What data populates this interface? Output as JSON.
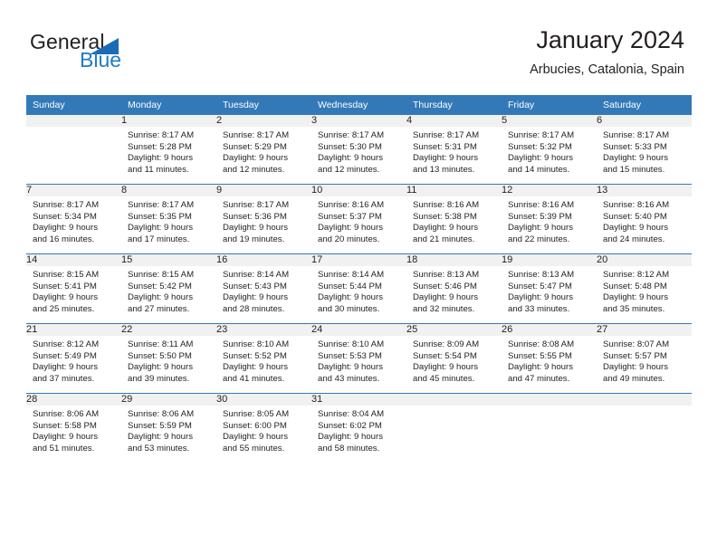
{
  "brand": {
    "name_part1": "General",
    "name_part2": "Blue",
    "accent_color": "#1f7cc4",
    "triangle_color": "#1b6cb5"
  },
  "header": {
    "title": "January 2024",
    "subtitle": "Arbucies, Catalonia, Spain"
  },
  "calendar": {
    "header_bg": "#3379b8",
    "daynum_bg": "#f1f1f1",
    "columns": [
      "Sunday",
      "Monday",
      "Tuesday",
      "Wednesday",
      "Thursday",
      "Friday",
      "Saturday"
    ],
    "weeks": [
      [
        {
          "day": "",
          "lines": [
            "",
            "",
            "",
            ""
          ]
        },
        {
          "day": "1",
          "lines": [
            "Sunrise: 8:17 AM",
            "Sunset: 5:28 PM",
            "Daylight: 9 hours",
            "and 11 minutes."
          ]
        },
        {
          "day": "2",
          "lines": [
            "Sunrise: 8:17 AM",
            "Sunset: 5:29 PM",
            "Daylight: 9 hours",
            "and 12 minutes."
          ]
        },
        {
          "day": "3",
          "lines": [
            "Sunrise: 8:17 AM",
            "Sunset: 5:30 PM",
            "Daylight: 9 hours",
            "and 12 minutes."
          ]
        },
        {
          "day": "4",
          "lines": [
            "Sunrise: 8:17 AM",
            "Sunset: 5:31 PM",
            "Daylight: 9 hours",
            "and 13 minutes."
          ]
        },
        {
          "day": "5",
          "lines": [
            "Sunrise: 8:17 AM",
            "Sunset: 5:32 PM",
            "Daylight: 9 hours",
            "and 14 minutes."
          ]
        },
        {
          "day": "6",
          "lines": [
            "Sunrise: 8:17 AM",
            "Sunset: 5:33 PM",
            "Daylight: 9 hours",
            "and 15 minutes."
          ]
        }
      ],
      [
        {
          "day": "7",
          "lines": [
            "Sunrise: 8:17 AM",
            "Sunset: 5:34 PM",
            "Daylight: 9 hours",
            "and 16 minutes."
          ]
        },
        {
          "day": "8",
          "lines": [
            "Sunrise: 8:17 AM",
            "Sunset: 5:35 PM",
            "Daylight: 9 hours",
            "and 17 minutes."
          ]
        },
        {
          "day": "9",
          "lines": [
            "Sunrise: 8:17 AM",
            "Sunset: 5:36 PM",
            "Daylight: 9 hours",
            "and 19 minutes."
          ]
        },
        {
          "day": "10",
          "lines": [
            "Sunrise: 8:16 AM",
            "Sunset: 5:37 PM",
            "Daylight: 9 hours",
            "and 20 minutes."
          ]
        },
        {
          "day": "11",
          "lines": [
            "Sunrise: 8:16 AM",
            "Sunset: 5:38 PM",
            "Daylight: 9 hours",
            "and 21 minutes."
          ]
        },
        {
          "day": "12",
          "lines": [
            "Sunrise: 8:16 AM",
            "Sunset: 5:39 PM",
            "Daylight: 9 hours",
            "and 22 minutes."
          ]
        },
        {
          "day": "13",
          "lines": [
            "Sunrise: 8:16 AM",
            "Sunset: 5:40 PM",
            "Daylight: 9 hours",
            "and 24 minutes."
          ]
        }
      ],
      [
        {
          "day": "14",
          "lines": [
            "Sunrise: 8:15 AM",
            "Sunset: 5:41 PM",
            "Daylight: 9 hours",
            "and 25 minutes."
          ]
        },
        {
          "day": "15",
          "lines": [
            "Sunrise: 8:15 AM",
            "Sunset: 5:42 PM",
            "Daylight: 9 hours",
            "and 27 minutes."
          ]
        },
        {
          "day": "16",
          "lines": [
            "Sunrise: 8:14 AM",
            "Sunset: 5:43 PM",
            "Daylight: 9 hours",
            "and 28 minutes."
          ]
        },
        {
          "day": "17",
          "lines": [
            "Sunrise: 8:14 AM",
            "Sunset: 5:44 PM",
            "Daylight: 9 hours",
            "and 30 minutes."
          ]
        },
        {
          "day": "18",
          "lines": [
            "Sunrise: 8:13 AM",
            "Sunset: 5:46 PM",
            "Daylight: 9 hours",
            "and 32 minutes."
          ]
        },
        {
          "day": "19",
          "lines": [
            "Sunrise: 8:13 AM",
            "Sunset: 5:47 PM",
            "Daylight: 9 hours",
            "and 33 minutes."
          ]
        },
        {
          "day": "20",
          "lines": [
            "Sunrise: 8:12 AM",
            "Sunset: 5:48 PM",
            "Daylight: 9 hours",
            "and 35 minutes."
          ]
        }
      ],
      [
        {
          "day": "21",
          "lines": [
            "Sunrise: 8:12 AM",
            "Sunset: 5:49 PM",
            "Daylight: 9 hours",
            "and 37 minutes."
          ]
        },
        {
          "day": "22",
          "lines": [
            "Sunrise: 8:11 AM",
            "Sunset: 5:50 PM",
            "Daylight: 9 hours",
            "and 39 minutes."
          ]
        },
        {
          "day": "23",
          "lines": [
            "Sunrise: 8:10 AM",
            "Sunset: 5:52 PM",
            "Daylight: 9 hours",
            "and 41 minutes."
          ]
        },
        {
          "day": "24",
          "lines": [
            "Sunrise: 8:10 AM",
            "Sunset: 5:53 PM",
            "Daylight: 9 hours",
            "and 43 minutes."
          ]
        },
        {
          "day": "25",
          "lines": [
            "Sunrise: 8:09 AM",
            "Sunset: 5:54 PM",
            "Daylight: 9 hours",
            "and 45 minutes."
          ]
        },
        {
          "day": "26",
          "lines": [
            "Sunrise: 8:08 AM",
            "Sunset: 5:55 PM",
            "Daylight: 9 hours",
            "and 47 minutes."
          ]
        },
        {
          "day": "27",
          "lines": [
            "Sunrise: 8:07 AM",
            "Sunset: 5:57 PM",
            "Daylight: 9 hours",
            "and 49 minutes."
          ]
        }
      ],
      [
        {
          "day": "28",
          "lines": [
            "Sunrise: 8:06 AM",
            "Sunset: 5:58 PM",
            "Daylight: 9 hours",
            "and 51 minutes."
          ]
        },
        {
          "day": "29",
          "lines": [
            "Sunrise: 8:06 AM",
            "Sunset: 5:59 PM",
            "Daylight: 9 hours",
            "and 53 minutes."
          ]
        },
        {
          "day": "30",
          "lines": [
            "Sunrise: 8:05 AM",
            "Sunset: 6:00 PM",
            "Daylight: 9 hours",
            "and 55 minutes."
          ]
        },
        {
          "day": "31",
          "lines": [
            "Sunrise: 8:04 AM",
            "Sunset: 6:02 PM",
            "Daylight: 9 hours",
            "and 58 minutes."
          ]
        },
        {
          "day": "",
          "lines": [
            "",
            "",
            "",
            ""
          ]
        },
        {
          "day": "",
          "lines": [
            "",
            "",
            "",
            ""
          ]
        },
        {
          "day": "",
          "lines": [
            "",
            "",
            "",
            ""
          ]
        }
      ]
    ]
  }
}
